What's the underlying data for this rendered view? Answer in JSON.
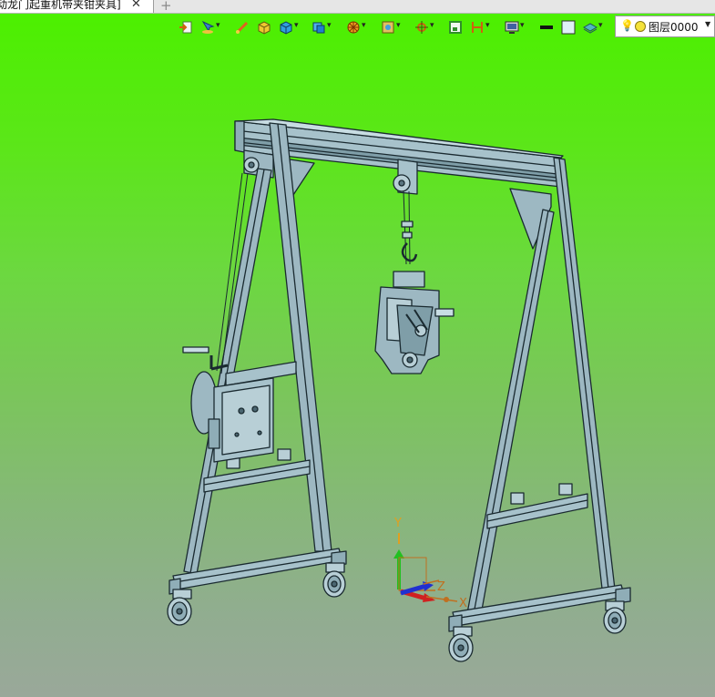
{
  "tab": {
    "title": "动龙门起重机带夹钳夹具]",
    "close_glyph": "✕",
    "new_tab_glyph": "+"
  },
  "toolbar": {
    "icons": [
      "import-icon",
      "select-filter-icon",
      "line-tool-icon",
      "solid-box-icon",
      "shaded-view-icon",
      "view-cube-icon",
      "render-style-icon",
      "section-view-icon",
      "snap-icon",
      "sketch-plane-icon",
      "measure-icon",
      "display-settings-icon"
    ],
    "line_color": "#111111",
    "fill_color": "#dff0f7",
    "layer": {
      "name": "图层0000"
    }
  },
  "axes": {
    "x": "X",
    "y": "Y",
    "z": "Z"
  },
  "colors": {
    "frame": "#9db8c2",
    "frame_edge": "#1a2a30",
    "background_top": "#4cf000",
    "background_bottom": "#9aa89a"
  }
}
